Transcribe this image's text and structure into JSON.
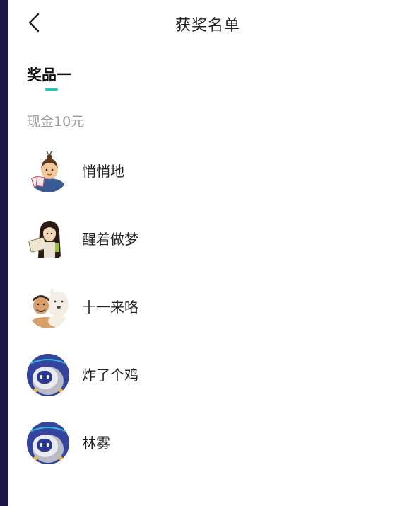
{
  "header": {
    "title": "获奖名单",
    "back_icon": "chevron-left-icon"
  },
  "prize": {
    "tab_label": "奖品一",
    "description": "现金10元"
  },
  "winners": [
    {
      "name": "悄悄地",
      "avatar": "illustrated-woman-with-cards-avatar"
    },
    {
      "name": "醒着做梦",
      "avatar": "illustrated-long-hair-woman-avatar"
    },
    {
      "name": "十一来咯",
      "avatar": "illustrated-man-with-dog-avatar"
    },
    {
      "name": "炸了个鸡",
      "avatar": "default-robot-avatar"
    },
    {
      "name": "林雾",
      "avatar": "default-robot-avatar"
    }
  ],
  "colors": {
    "accent": "#1ec9b5",
    "rail": "#1d1546",
    "robot_bg": "#3848a8"
  }
}
